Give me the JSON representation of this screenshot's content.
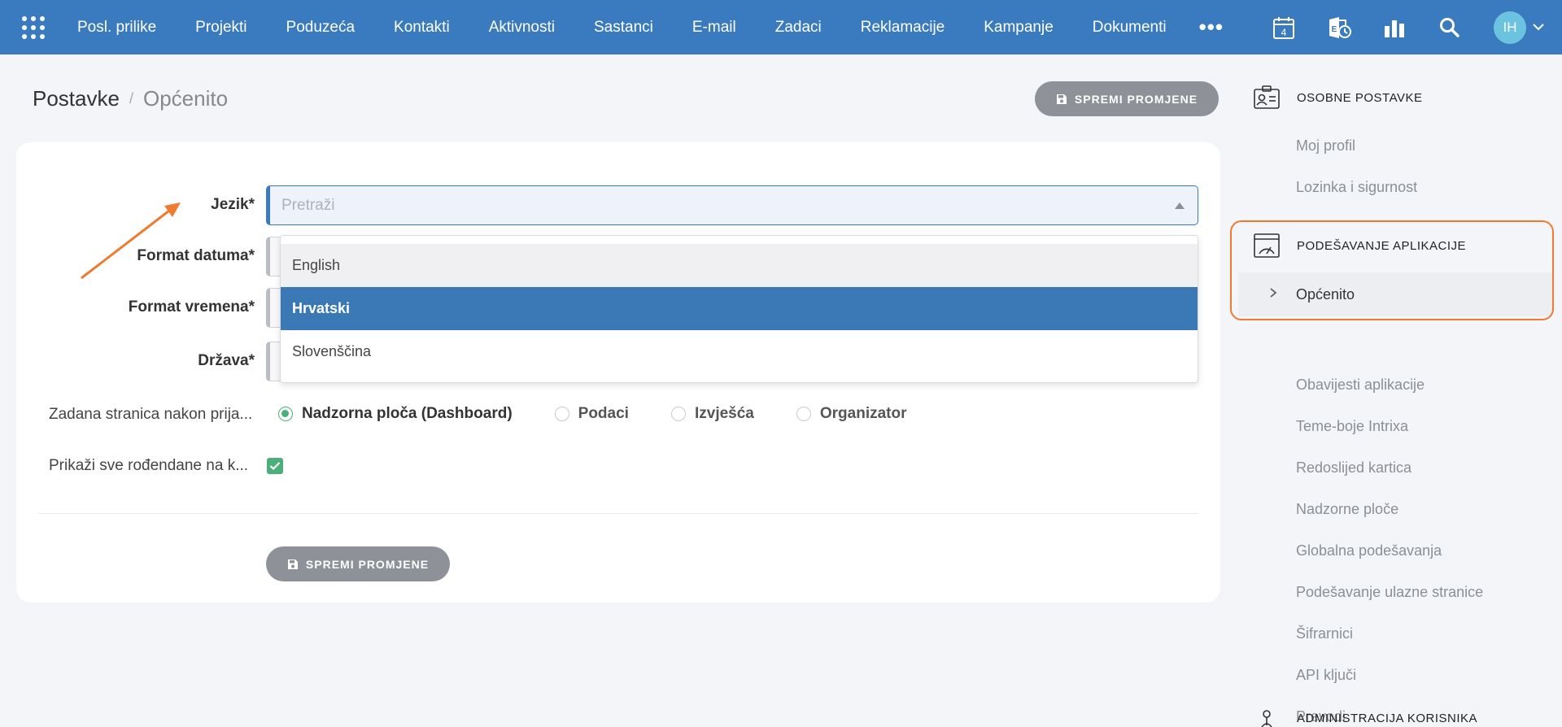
{
  "nav": {
    "items": [
      "Posl. prilike",
      "Projekti",
      "Poduzeća",
      "Kontakti",
      "Aktivnosti",
      "Sastanci",
      "E-mail",
      "Zadaci",
      "Reklamacije",
      "Kampanje",
      "Dokumenti"
    ],
    "more": "•••",
    "calendar_day": "4",
    "avatar_initials": "IH"
  },
  "breadcrumb": {
    "root": "Postavke",
    "separator": "/",
    "current": "Općenito"
  },
  "save_button_label": "SPREMI PROMJENE",
  "form": {
    "language_label": "Jezik*",
    "language_placeholder": "Pretraži",
    "date_format_label": "Format datuma*",
    "time_format_label": "Format vremena*",
    "country_label": "Država*",
    "default_page_label": "Zadana stranica nakon prija...",
    "default_page_options": [
      "Nadzorna ploča (Dashboard)",
      "Podaci",
      "Izvješća",
      "Organizator"
    ],
    "default_page_selected": "Nadzorna ploča (Dashboard)",
    "birthdays_label": "Prikaži sve rođendane na k...",
    "birthdays_checked": true
  },
  "dropdown": {
    "options": [
      "English",
      "Hrvatski",
      "Slovenščina"
    ],
    "selected": "Hrvatski",
    "hovered": "English"
  },
  "sidebar": {
    "personal_title": "OSOBNE POSTAVKE",
    "personal_items": [
      "Moj profil",
      "Lozinka i sigurnost"
    ],
    "app_title": "PODEŠAVANJE APLIKACIJE",
    "app_items": [
      "Općenito",
      "Obavijesti aplikacije",
      "Teme-boje Intrixa",
      "Redoslijed kartica",
      "Nadzorne ploče",
      "Globalna podešavanja",
      "Podešavanje ulazne stranice",
      "Šifrarnici",
      "API ključi",
      "Prevodi"
    ],
    "admin_title": "ADMINISTRACIJA KORISNIKA"
  },
  "colors": {
    "nav_bg": "#3a7bc0",
    "selected_option": "#3a79b6",
    "accent_green": "#4caf7a",
    "annotation_orange": "#ee7b2f",
    "button_gray": "#8e9197"
  }
}
